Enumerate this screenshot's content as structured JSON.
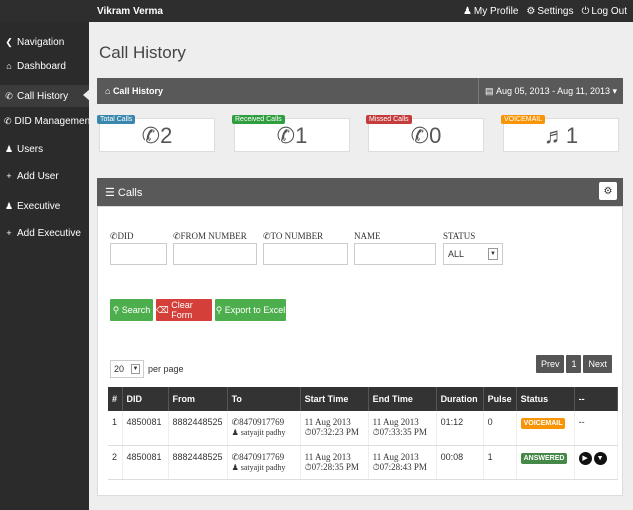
{
  "topbar": {
    "user": "Vikram Verma",
    "my_profile": "My Profile",
    "settings": "Settings",
    "logout": "Log Out"
  },
  "sidebar": {
    "items": [
      {
        "label": "Navigation",
        "icon": "chevron-left-icon"
      },
      {
        "label": "Dashboard",
        "icon": "home-icon"
      },
      {
        "label": "Call History",
        "icon": "phone-icon"
      },
      {
        "label": "DID Management",
        "icon": "phone-icon"
      },
      {
        "label": "Users",
        "icon": "user-icon"
      },
      {
        "label": "Add User",
        "icon": "plus-icon"
      },
      {
        "label": "Executive",
        "icon": "user-icon"
      },
      {
        "label": "Add Executive",
        "icon": "plus-icon"
      }
    ]
  },
  "page": {
    "title": "Call History",
    "breadcrumb": "Call History",
    "date_range": "Aug 05, 2013 - Aug 11, 2013"
  },
  "stats": [
    {
      "label": "Total Calls",
      "value": "2",
      "color": "#3a87ad"
    },
    {
      "label": "Received Calls",
      "value": "1",
      "color": "#2e9e3e"
    },
    {
      "label": "Missed Calls",
      "value": "0",
      "color": "#c43c3c"
    },
    {
      "label": "VOICEMAIL",
      "value": "1",
      "color": "#f89406"
    }
  ],
  "panel": {
    "title": "Calls"
  },
  "filters": {
    "did": "DID",
    "from": "FROM NUMBER",
    "to": "TO NUMBER",
    "name": "NAME",
    "status": "STATUS",
    "status_value": "ALL"
  },
  "buttons": {
    "search": "Search",
    "clear": "Clear Form",
    "export": "Export to Excel"
  },
  "perpage": {
    "value": "20",
    "label": "per page"
  },
  "pager": {
    "prev": "Prev",
    "page": "1",
    "next": "Next"
  },
  "table": {
    "headers": [
      "#",
      "DID",
      "From",
      "To",
      "Start Time",
      "End Time",
      "Duration",
      "Pulse",
      "Status",
      "--"
    ],
    "rows": [
      {
        "n": "1",
        "did": "4850081",
        "from": "8882448525",
        "to": "8470917769",
        "to_name": "satyajit padhy",
        "start_date": "11 Aug 2013",
        "start_time": "07:32:23 PM",
        "end_date": "11 Aug 2013",
        "end_time": "07:33:35 PM",
        "duration": "01:12",
        "pulse": "0",
        "status": "VOICEMAIL",
        "status_color": "#f89406",
        "action": "--"
      },
      {
        "n": "2",
        "did": "4850081",
        "from": "8882448525",
        "to": "8470917769",
        "to_name": "satyajit padhy",
        "start_date": "11 Aug 2013",
        "start_time": "07:28:35 PM",
        "end_date": "11 Aug 2013",
        "end_time": "07:28:43 PM",
        "duration": "00:08",
        "pulse": "1",
        "status": "ANSWERED",
        "status_color": "#468847",
        "action": ""
      }
    ]
  }
}
